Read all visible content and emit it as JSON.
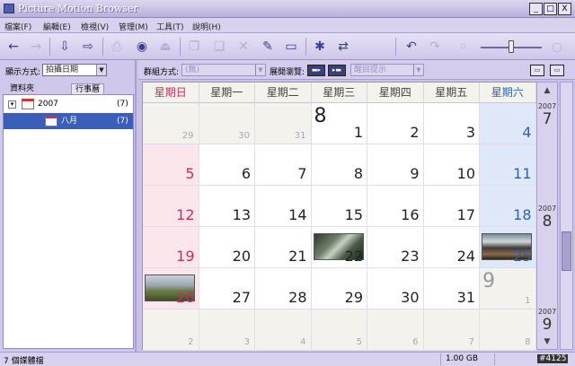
{
  "window": {
    "title": "Picture Motion Browser",
    "buttons": [
      "_",
      "□",
      "X"
    ]
  },
  "menu": [
    "檔案(F)",
    "編輯(E)",
    "檢視(V)",
    "管理(M)",
    "工具(T)",
    "說明(H)"
  ],
  "toolbar": {
    "icons": [
      "back-arrow-icon",
      "forward-arrow-icon",
      "import-icon",
      "export-icon",
      "print-icon",
      "burn-disc-icon",
      "upload-icon",
      "copy-icon",
      "paste-icon",
      "delete-icon",
      "edit-icon",
      "slideshow-icon",
      "tools-icon",
      "transfer-icon",
      "rotate-left-icon",
      "rotate-right-icon",
      "small-thumbnail-icon",
      "large-thumbnail-icon"
    ]
  },
  "left_pane": {
    "display_label": "顯示方式:",
    "display_value": "拍攝日期",
    "tabs": [
      "資料夾",
      "行事曆"
    ],
    "tree": [
      {
        "label": "2007",
        "count": "(7)"
      },
      {
        "label": "八月",
        "count": "(7)"
      }
    ]
  },
  "group_bar": {
    "group_label": "群組方式:",
    "group_value": "(無)",
    "expand_label": "展開瀏覽:",
    "tooltip_value": "醒目提示"
  },
  "calendar": {
    "headers": [
      "星期日",
      "星期一",
      "星期二",
      "星期三",
      "星期四",
      "星期五",
      "星期六"
    ],
    "header_colors": [
      "#c03058",
      "#444444",
      "#444444",
      "#444444",
      "#444444",
      "#444444",
      "#2a64b0"
    ],
    "rows": [
      [
        {
          "n": "29",
          "t": "other"
        },
        {
          "n": "30",
          "t": "other"
        },
        {
          "n": "31",
          "t": "other"
        },
        {
          "n": "1",
          "t": "cur",
          "month": "8"
        },
        {
          "n": "2",
          "t": "cur"
        },
        {
          "n": "3",
          "t": "cur"
        },
        {
          "n": "4",
          "t": "sat"
        }
      ],
      [
        {
          "n": "5",
          "t": "sun"
        },
        {
          "n": "6",
          "t": "cur"
        },
        {
          "n": "7",
          "t": "cur"
        },
        {
          "n": "8",
          "t": "cur"
        },
        {
          "n": "9",
          "t": "cur"
        },
        {
          "n": "10",
          "t": "cur"
        },
        {
          "n": "11",
          "t": "sat"
        }
      ],
      [
        {
          "n": "12",
          "t": "sun"
        },
        {
          "n": "13",
          "t": "cur"
        },
        {
          "n": "14",
          "t": "cur"
        },
        {
          "n": "15",
          "t": "cur"
        },
        {
          "n": "16",
          "t": "cur"
        },
        {
          "n": "17",
          "t": "cur"
        },
        {
          "n": "18",
          "t": "sat"
        }
      ],
      [
        {
          "n": "19",
          "t": "sun"
        },
        {
          "n": "20",
          "t": "cur"
        },
        {
          "n": "21",
          "t": "cur"
        },
        {
          "n": "22",
          "t": "cur",
          "photo": "photo-1"
        },
        {
          "n": "23",
          "t": "cur"
        },
        {
          "n": "24",
          "t": "cur"
        },
        {
          "n": "25",
          "t": "sat",
          "photo": "photo-2"
        }
      ],
      [
        {
          "n": "26",
          "t": "sun",
          "photo": "photo-3"
        },
        {
          "n": "27",
          "t": "cur"
        },
        {
          "n": "28",
          "t": "cur"
        },
        {
          "n": "29",
          "t": "cur"
        },
        {
          "n": "30",
          "t": "cur"
        },
        {
          "n": "31",
          "t": "cur"
        },
        {
          "n": "1",
          "t": "other",
          "month": "9"
        }
      ],
      [
        {
          "n": "2",
          "t": "other"
        },
        {
          "n": "3",
          "t": "other"
        },
        {
          "n": "4",
          "t": "other"
        },
        {
          "n": "5",
          "t": "other"
        },
        {
          "n": "6",
          "t": "other"
        },
        {
          "n": "7",
          "t": "other"
        },
        {
          "n": "8",
          "t": "other"
        }
      ]
    ]
  },
  "side": {
    "year_top": "2007",
    "month_top": "7",
    "year_mid": "2007",
    "month_mid": "8",
    "year_bot": "2007",
    "month_bot": "9"
  },
  "status": {
    "left": "7 個媒體檔",
    "size": "1.00 GB",
    "id": "#4125"
  }
}
